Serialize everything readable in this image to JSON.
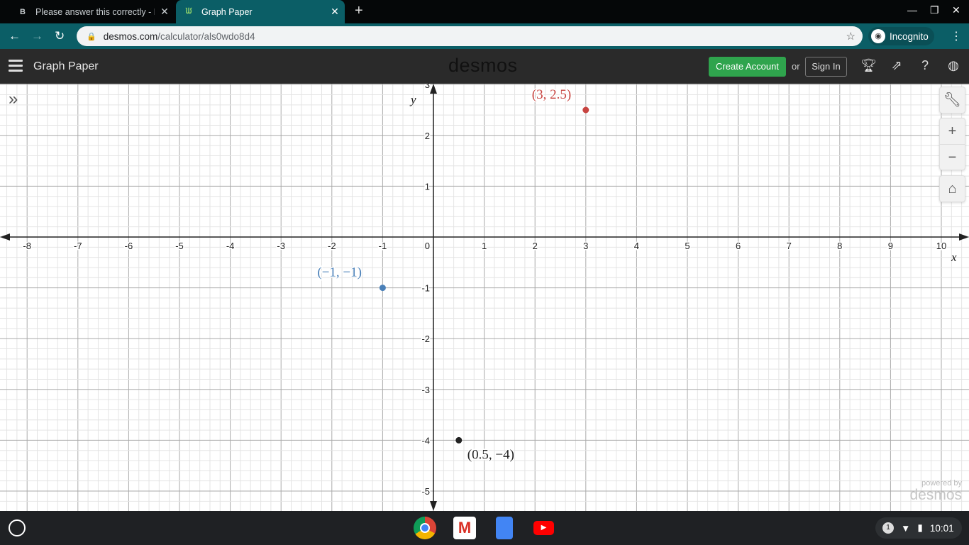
{
  "browser": {
    "tabs": [
      {
        "title": "Please answer this correctly - Brainly",
        "favicon": "B"
      },
      {
        "title": "Graph Paper",
        "favicon": "desmos-icon"
      }
    ],
    "url_host": "desmos.com",
    "url_path": "/calculator/als0wdo8d4",
    "profile": "Incognito"
  },
  "desmos": {
    "title": "Graph Paper",
    "logo": "desmos",
    "create_account": "Create Account",
    "or": "or",
    "sign_in": "Sign In",
    "powered_by": "powered by",
    "powered_logo": "desmos"
  },
  "graph": {
    "x_label": "x",
    "y_label": "y",
    "x_range": [
      -8.5,
      10.5
    ],
    "y_range": [
      -5.4,
      3.0
    ],
    "x_ticks": [
      -8,
      -7,
      -6,
      -5,
      -4,
      -3,
      -2,
      -1,
      1,
      2,
      3,
      4,
      5,
      6,
      7,
      8,
      9,
      10
    ],
    "y_ticks": [
      -5,
      -4,
      -3,
      -2,
      -1,
      1,
      2,
      3
    ],
    "origin_label": "0",
    "points": [
      {
        "x": -1,
        "y": -1,
        "label": "(−1, −1)",
        "color": "#4a80b8"
      },
      {
        "x": 3,
        "y": 2.5,
        "label": "(3, 2.5)",
        "color": "#c74440"
      },
      {
        "x": 0.5,
        "y": -4,
        "label": "(0.5, −4)",
        "color": "#222222"
      }
    ]
  },
  "taskbar": {
    "time": "10:01",
    "notifications": "1"
  }
}
